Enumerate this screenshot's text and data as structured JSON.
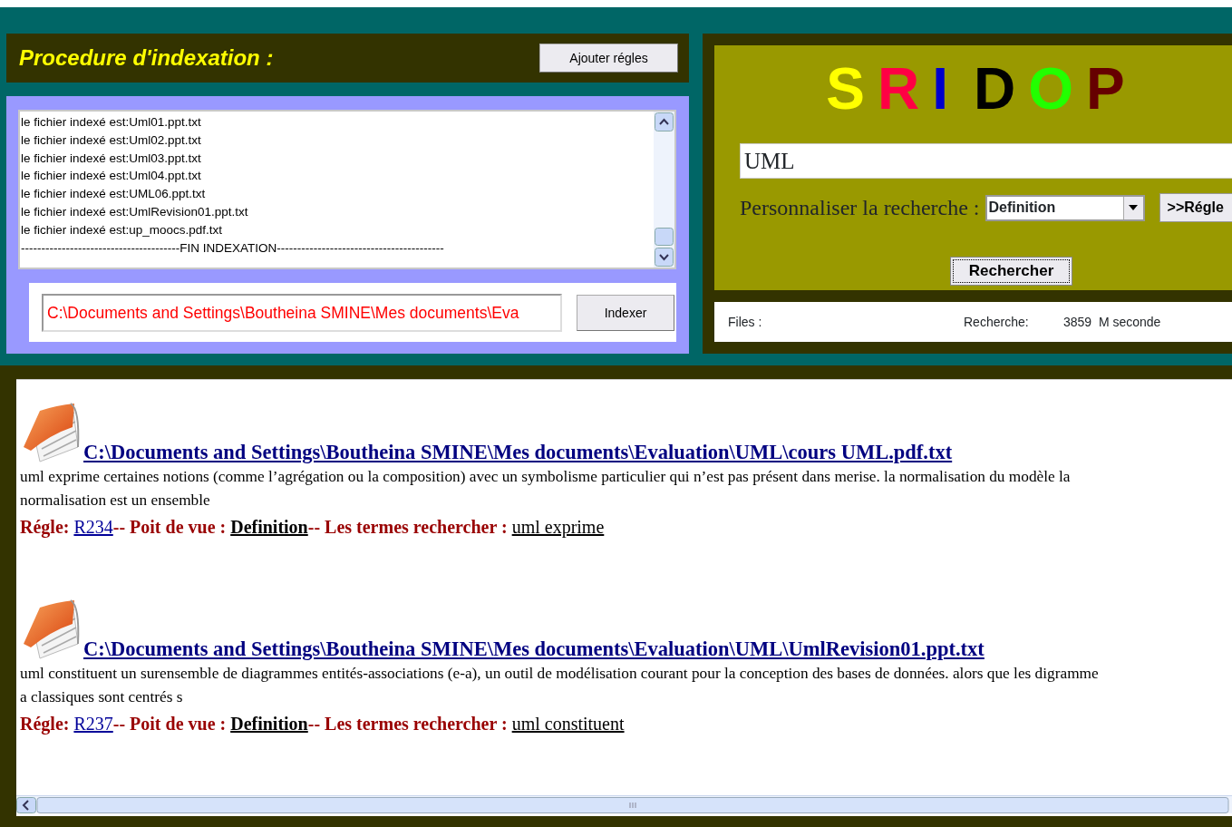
{
  "indexing": {
    "title": "Procedure d'indexation :",
    "add_rules_button": "Ajouter régles",
    "log_lines": [
      "le fichier indexé est:Uml01.ppt.txt",
      "le fichier indexé est:Uml02.ppt.txt",
      "le fichier indexé est:Uml03.ppt.txt",
      "le fichier indexé est:Uml04.ppt.txt",
      "le fichier indexé est:UML06.ppt.txt",
      "le fichier indexé est:UmlRevision01.ppt.txt",
      "le fichier indexé est:up_moocs.pdf.txt",
      "---------------------------------------FIN INDEXATION-----------------------------------------"
    ],
    "path_value": "C:\\Documents and Settings\\Boutheina SMINE\\Mes documents\\Eva",
    "index_button": "Indexer"
  },
  "search": {
    "logo_words": [
      {
        "letters": [
          {
            "text": "S",
            "color": "#ffff00"
          },
          {
            "text": "R",
            "color": "#ff0044"
          },
          {
            "text": "I",
            "color": "#0000cc"
          }
        ]
      },
      {
        "letters": [
          {
            "text": "D",
            "color": "#000000"
          },
          {
            "text": "O",
            "color": "#22ff00"
          },
          {
            "text": "P",
            "color": "#660000"
          }
        ]
      }
    ],
    "query": "UML",
    "customize_label": "Personnaliser la recherche :",
    "view_select": "Definition",
    "rules_button": ">>Régle",
    "search_button": "Rechercher"
  },
  "status": {
    "files_label": "Files :",
    "search_label": "Recherche:",
    "search_time": "3859  M seconde"
  },
  "results": [
    {
      "path": "C:\\Documents and Settings\\Boutheina SMINE\\Mes documents\\Evaluation\\UML\\cours UML.pdf.txt",
      "snippet_lines": [
        "uml exprime certaines notions (comme l’agrégation ou la composition) avec un symbolisme particulier qui n’est pas présent dans merise. la normalisation du modèle la",
        "normalisation est un ensemble"
      ],
      "rule_label": "Régle:",
      "rule": "R234",
      "view_label": "-- Poit de vue :",
      "view": "Definition",
      "terms_label": "-- Les termes rechercher :",
      "terms": "uml exprime"
    },
    {
      "path": "C:\\Documents and Settings\\Boutheina SMINE\\Mes documents\\Evaluation\\UML\\UmlRevision01.ppt.txt",
      "snippet_lines": [
        "uml constituent un surensemble de diagrammes entités-associations (e-a), un outil de modélisation courant pour la conception des bases de données. alors que les digramme",
        "a classiques sont centrés s"
      ],
      "rule_label": "Régle:",
      "rule": "R237",
      "view_label": "-- Poit de vue :",
      "view": "Definition",
      "terms_label": "-- Les termes rechercher :",
      "terms": "uml constituent"
    }
  ]
}
